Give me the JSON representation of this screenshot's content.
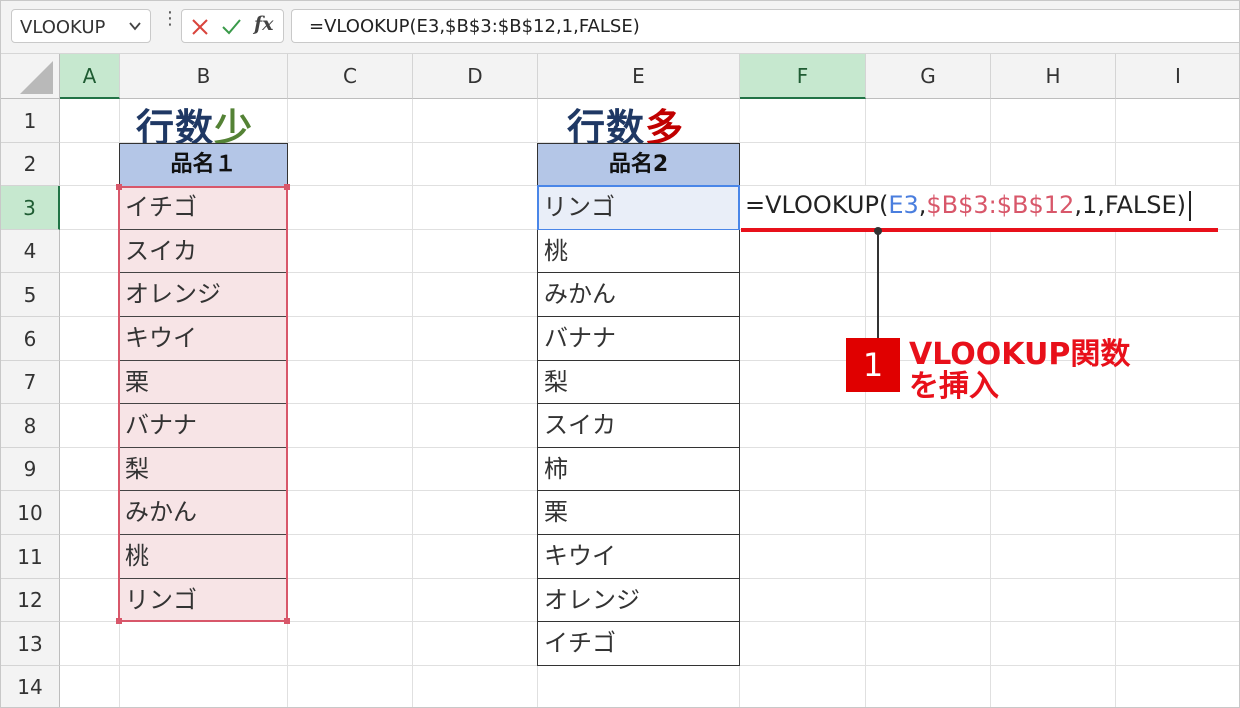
{
  "formula_bar": {
    "name_box": "VLOOKUP",
    "formula": "=VLOOKUP(E3,$B$3:$B$12,1,FALSE)",
    "insert_function_label": "fx"
  },
  "columns": [
    "A",
    "B",
    "C",
    "D",
    "E",
    "F",
    "G",
    "H",
    "I"
  ],
  "rows": [
    "1",
    "2",
    "3",
    "4",
    "5",
    "6",
    "7",
    "8",
    "9",
    "10",
    "11",
    "12",
    "13",
    "14"
  ],
  "title_left": {
    "main": "行数",
    "accent": "少",
    "accent_color": "#548235"
  },
  "title_right": {
    "main": "行数",
    "accent": "多",
    "accent_color": "#c00000"
  },
  "table_b": {
    "header": "品名１",
    "items": [
      "イチゴ",
      "スイカ",
      "オレンジ",
      "キウイ",
      "栗",
      "バナナ",
      "梨",
      "みかん",
      "桃",
      "リンゴ"
    ]
  },
  "table_e": {
    "header": "品名2",
    "items": [
      "リンゴ",
      "桃",
      "みかん",
      "バナナ",
      "梨",
      "スイカ",
      "柿",
      "栗",
      "キウイ",
      "オレンジ",
      "イチゴ"
    ]
  },
  "cell_edit": {
    "prefix": "=VLOOKUP(",
    "arg1": "E3",
    "sep1": ",",
    "arg2": "$B$3:$B$12",
    "rest": ",1,FALSE)",
    "arg1_color": "#4a7ede",
    "arg2_color": "#d8576a"
  },
  "callout": {
    "number": "1",
    "line1": "VLOOKUP関数",
    "line2": "を挿入"
  }
}
